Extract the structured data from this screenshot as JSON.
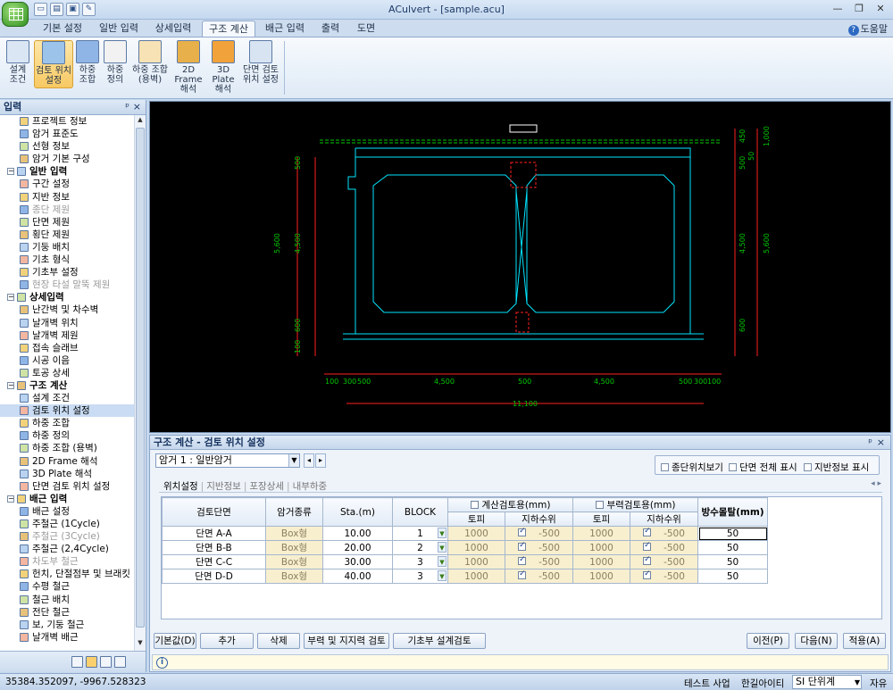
{
  "app": {
    "title": "ACulvert - [sample.acu]",
    "help": "도움말",
    "qat": [
      "▭",
      "▤",
      "▣",
      "✎"
    ],
    "win_controls": [
      "—",
      "❐",
      "✕"
    ]
  },
  "ribbon_tabs": [
    {
      "label": "기본 설정",
      "active": false
    },
    {
      "label": "일반 입력",
      "active": false
    },
    {
      "label": "상세입력",
      "active": false
    },
    {
      "label": "구조 계산",
      "active": true
    },
    {
      "label": "배근 입력",
      "active": false
    },
    {
      "label": "출력",
      "active": false
    },
    {
      "label": "도면",
      "active": false
    }
  ],
  "ribbon_buttons": [
    {
      "line1": "설계",
      "line2": "조건",
      "icon": "design-conditions-icon",
      "active": false
    },
    {
      "line1": "검토 위치",
      "line2": "설정",
      "icon": "review-location-icon",
      "active": true
    },
    {
      "line1": "하중",
      "line2": "조합",
      "icon": "load-combination-icon",
      "active": false
    },
    {
      "line1": "하중",
      "line2": "정의",
      "icon": "load-definition-icon",
      "active": false
    },
    {
      "line1": "하중 조합",
      "line2": "(용벽)",
      "icon": "wall-load-combination-icon",
      "active": false
    },
    {
      "line1": "2D Frame",
      "line2": "해석",
      "icon": "frame-2d-icon",
      "active": false
    },
    {
      "line1": "3D Plate",
      "line2": "해석",
      "icon": "plate-3d-icon",
      "active": false
    },
    {
      "line1": "단면 검토",
      "line2": "위치 설정",
      "icon": "section-location-icon",
      "active": false
    }
  ],
  "left_panel": {
    "title": "입력",
    "pin": "ᵖ",
    "close": "×",
    "tree": [
      {
        "label": "프로젝트 정보",
        "level": 1,
        "kind": "item"
      },
      {
        "label": "암거 표준도",
        "level": 1,
        "kind": "item"
      },
      {
        "label": "선형 정보",
        "level": 1,
        "kind": "item"
      },
      {
        "label": "암거 기본 구성",
        "level": 1,
        "kind": "item"
      },
      {
        "label": "일반 입력",
        "level": 0,
        "kind": "group"
      },
      {
        "label": "구간 설정",
        "level": 1,
        "kind": "item"
      },
      {
        "label": "지반 정보",
        "level": 1,
        "kind": "item"
      },
      {
        "label": "종단 제원",
        "level": 1,
        "kind": "disabled"
      },
      {
        "label": "단면 제원",
        "level": 1,
        "kind": "item"
      },
      {
        "label": "횡단 제원",
        "level": 1,
        "kind": "item"
      },
      {
        "label": "기둥 배치",
        "level": 1,
        "kind": "item"
      },
      {
        "label": "기초 형식",
        "level": 1,
        "kind": "item"
      },
      {
        "label": "기초부 설정",
        "level": 1,
        "kind": "item"
      },
      {
        "label": "현장 타설 말뚝 제원",
        "level": 1,
        "kind": "disabled"
      },
      {
        "label": "상세입력",
        "level": 0,
        "kind": "group"
      },
      {
        "label": "난간벽 및 차수벽",
        "level": 1,
        "kind": "item"
      },
      {
        "label": "날개벽 위치",
        "level": 1,
        "kind": "item"
      },
      {
        "label": "날개벽 제원",
        "level": 1,
        "kind": "item"
      },
      {
        "label": "접속 슬래브",
        "level": 1,
        "kind": "item"
      },
      {
        "label": "시공 이음",
        "level": 1,
        "kind": "item"
      },
      {
        "label": "토공 상세",
        "level": 1,
        "kind": "item"
      },
      {
        "label": "구조 계산",
        "level": 0,
        "kind": "group"
      },
      {
        "label": "설계 조건",
        "level": 1,
        "kind": "item"
      },
      {
        "label": "검토 위치 설정",
        "level": 1,
        "kind": "selected"
      },
      {
        "label": "하중 조합",
        "level": 1,
        "kind": "item"
      },
      {
        "label": "하중 정의",
        "level": 1,
        "kind": "item"
      },
      {
        "label": "하중 조합 (용벽)",
        "level": 1,
        "kind": "item"
      },
      {
        "label": "2D Frame 해석",
        "level": 1,
        "kind": "item"
      },
      {
        "label": "3D Plate 해석",
        "level": 1,
        "kind": "item"
      },
      {
        "label": "단면 검토 위치 설정",
        "level": 1,
        "kind": "item"
      },
      {
        "label": "배근 입력",
        "level": 0,
        "kind": "group"
      },
      {
        "label": "배근 설정",
        "level": 1,
        "kind": "item"
      },
      {
        "label": "주철근 (1Cycle)",
        "level": 1,
        "kind": "item"
      },
      {
        "label": "주철근 (3Cycle)",
        "level": 1,
        "kind": "disabled"
      },
      {
        "label": "주철근 (2,4Cycle)",
        "level": 1,
        "kind": "item"
      },
      {
        "label": "차도부 철근",
        "level": 1,
        "kind": "disabled"
      },
      {
        "label": "헌치, 단절점부 및 브래킷",
        "level": 1,
        "kind": "item"
      },
      {
        "label": "수평 철근",
        "level": 1,
        "kind": "item"
      },
      {
        "label": "철근 배치",
        "level": 1,
        "kind": "item"
      },
      {
        "label": "전단 철근",
        "level": 1,
        "kind": "item"
      },
      {
        "label": "보, 기둥 철근",
        "level": 1,
        "kind": "item"
      },
      {
        "label": "날개벽 배근",
        "level": 1,
        "kind": "item"
      }
    ]
  },
  "drawing": {
    "dims_left": [
      "500",
      "4,500",
      "600",
      "100",
      "5,600"
    ],
    "dims_right_top": [
      "450",
      "500",
      "50",
      "1,000"
    ],
    "dims_right": [
      "500",
      "4,500",
      "600",
      "5,600"
    ],
    "dims_bottom": [
      "100",
      "300",
      "500",
      "4,500",
      "500",
      "4,500",
      "500",
      "300",
      "100"
    ],
    "dim_total": "11,100"
  },
  "calc_panel": {
    "title": "구조 계산 - 검토 위치 설정",
    "pin": "ᵖ",
    "close": "×",
    "culvert_select": "암거 1 : 일반암거",
    "nav_prev": "◂",
    "nav_next": "▸",
    "options": [
      {
        "label": "종단위치보기",
        "checked": false
      },
      {
        "label": "단면 전체 표시",
        "checked": false
      },
      {
        "label": "지반정보 표시",
        "checked": false
      }
    ],
    "subtabs": [
      {
        "label": "위치설정",
        "active": true
      },
      {
        "label": "지반정보",
        "active": false
      },
      {
        "label": "포장상세",
        "active": false
      },
      {
        "label": "내부하중",
        "active": false
      }
    ],
    "subtab_arrows": "◂ ▸",
    "grid": {
      "headers": {
        "section": "검토단면",
        "type": "암거종류",
        "sta": "Sta.(m)",
        "block": "BLOCK",
        "calc_group": "계산검토용(mm)",
        "buoy_group": "부력검토용(mm)",
        "cover": "토피",
        "gwl": "지하수위",
        "waterproof": "방수몰탈(mm)"
      },
      "rows": [
        {
          "section": "단면 A-A",
          "type": "Box형",
          "sta": "10.00",
          "block": "1",
          "calc_cover": "1000",
          "calc_gwl": "-500",
          "buoy_cover": "1000",
          "buoy_gwl": "-500",
          "waterproof": "50"
        },
        {
          "section": "단면 B-B",
          "type": "Box형",
          "sta": "20.00",
          "block": "2",
          "calc_cover": "1000",
          "calc_gwl": "-500",
          "buoy_cover": "1000",
          "buoy_gwl": "-500",
          "waterproof": "50"
        },
        {
          "section": "단면 C-C",
          "type": "Box형",
          "sta": "30.00",
          "block": "3",
          "calc_cover": "1000",
          "calc_gwl": "-500",
          "buoy_cover": "1000",
          "buoy_gwl": "-500",
          "waterproof": "50"
        },
        {
          "section": "단면 D-D",
          "type": "Box형",
          "sta": "40.00",
          "block": "3",
          "calc_cover": "1000",
          "calc_gwl": "-500",
          "buoy_cover": "1000",
          "buoy_gwl": "-500",
          "waterproof": "50"
        }
      ]
    },
    "buttons_left": [
      "기본값(D)",
      "추가",
      "삭제",
      "부력 및 지지력 검토",
      "기초부 설계검토"
    ],
    "buttons_right": [
      "이전(P)",
      "다음(N)",
      "적용(A)"
    ],
    "info_icon": "i"
  },
  "status": {
    "coords": "35384.352097,  -9967.528323",
    "project": "테스트 사업",
    "user": "한길아이티",
    "unit": "SI 단위계",
    "mode": "자유"
  },
  "colors": {
    "dim_green": "#00c800",
    "structure_cyan": "#00e5ff",
    "dim_red": "#ff2020",
    "ribbon_active": "#f7c964"
  }
}
